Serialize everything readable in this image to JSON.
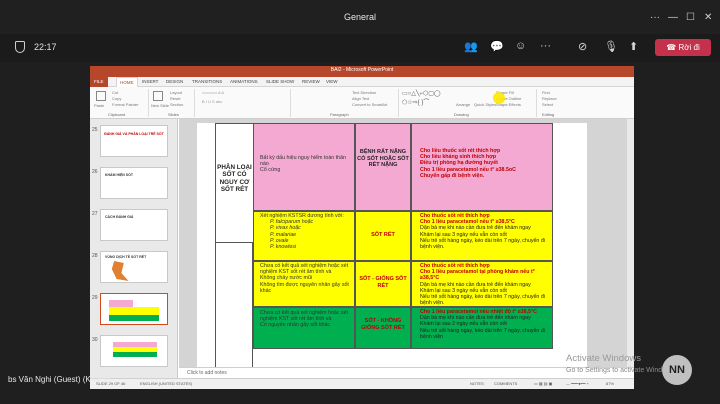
{
  "teams": {
    "title": "General",
    "time": "22:17",
    "leave_label": "Rời đi",
    "guest_name": "bs Văn Nghi (Guest) (Khách)",
    "avatar_initials": "NN",
    "watermark_line1": "Activate Windows",
    "watermark_line2": "Go to Settings to activate Windows."
  },
  "ppt": {
    "window_title": "BAI2 - Microsoft PowerPoint",
    "tabs": [
      "FILE",
      "HOME",
      "INSERT",
      "DESIGN",
      "TRANSITIONS",
      "ANIMATIONS",
      "SLIDE SHOW",
      "REVIEW",
      "VIEW"
    ],
    "ribbon": {
      "paste": "Paste",
      "cut": "Cut",
      "copy": "Copy",
      "format_painter": "Format Painter",
      "layout": "Layout",
      "reset": "Reset",
      "section": "Section",
      "new_slide": "New Slide",
      "text_direction": "Text Direction",
      "align_text": "Align Text",
      "convert_smartart": "Convert to SmartArt",
      "arrange": "Arrange",
      "quick_styles": "Quick Styles",
      "shape_fill": "Shape Fill",
      "shape_outline": "Shape Outline",
      "shape_effects": "Shape Effects",
      "find": "Find",
      "replace": "Replace",
      "select": "Select",
      "groups": [
        "Clipboard",
        "Slides",
        "Paragraph",
        "Drawing",
        "Editing"
      ]
    },
    "thumbnails": [
      {
        "num": "25",
        "title": "ĐÁNH GIÁ VÀ PHÂN LOẠI TRẺ SỐT"
      },
      {
        "num": "26",
        "title": "KHÁM HIỆN SỐT"
      },
      {
        "num": "27",
        "title": "CÁCH ĐÁNH GIÁ"
      },
      {
        "num": "28",
        "title": "VÙNG DỊCH TỄ SỐT RÉT"
      },
      {
        "num": "29",
        "title": ""
      },
      {
        "num": "30",
        "title": ""
      }
    ],
    "notes_placeholder": "Click to add notes",
    "status": {
      "slide": "SLIDE 29 OF 46",
      "lang": "ENGLISH (UNITED STATES)",
      "notes": "NOTES",
      "comments": "COMMENTS",
      "zoom": "87%"
    }
  },
  "slide_table": {
    "side_heading": "PHÂN LOẠI SỐT CÓ NGUY CƠ SỐT RÉT",
    "rows": [
      {
        "color": "#f4a9d2",
        "signs": [
          "Bất kỳ dấu hiệu nguy hiểm toàn thân nào",
          "Cổ cứng"
        ],
        "classification": "BỆNH RẤT NẶNG CÓ SỐT HOẶC SỐT RÉT NẶNG",
        "treatment": [
          "Cho liều thuốc sốt rét thích hợp",
          "Cho liều kháng sinh thích hợp",
          "Điều trị phòng hạ đường huyết",
          "Cho 1 liều paracetamol nếu t° ≥38.5oC",
          "Chuyển gấp đi bệnh viện."
        ]
      },
      {
        "color": "#ffff00",
        "signs": [
          "Xét nghiệm KSTSR dương tính với:",
          "P. falciparum hoặc",
          "P. vivax hoặc",
          "P. malariae",
          "P. ovale",
          "P. knowlesi"
        ],
        "classification": "SỐT RÉT",
        "treatment": [
          "Cho thuốc sốt rét thích hợp",
          "Cho 1 liều paracetamol nếu t° ≥38,5°C",
          "Dặn bà mẹ khi nào cần đưa trẻ đến khám ngay",
          "Khám lại sau 3 ngày nếu vẫn còn sốt",
          "Nếu trẻ sốt hàng ngày, kéo dài trên 7 ngày, chuyển đi bệnh viện."
        ]
      },
      {
        "color": "#ffff00",
        "signs": [
          "Chưa có kết quả xét nghiệm hoặc xét nghiệm KST sốt rét âm tính và",
          "Không chảy nước mũi",
          "Không tìm được nguyên nhân gây sốt khác"
        ],
        "classification": "SỐT - GIỐNG SỐT RÉT",
        "treatment": [
          "Cho thuốc sốt rét thích hợp",
          "Cho 1 liều paracetamol tại phòng khám nếu t° ≥38,5°C",
          "Dặn bà mẹ khi nào cần đưa trẻ đến khám ngay",
          "Khám lại sau 3 ngày nếu vẫn còn sốt",
          "Nếu trẻ sốt hàng ngày, kéo dài trên 7 ngày, chuyển đi bệnh viện."
        ]
      },
      {
        "color": "#00b050",
        "signs": [
          "Chưa có kết quả xét nghiệm hoặc xét nghiệm KST sốt rét âm tính và",
          "Có nguyên nhân gây sốt khác"
        ],
        "classification": "SỐT - KHÔNG GIỐNG SỐT RÉT",
        "treatment": [
          "Cho 1 liều paracetamol nếu nhiệt độ t° ≥38,5°C",
          "Dặn bà mẹ khi nào cần đưa trẻ đến khám ngay",
          "Khám lại sau 2 ngày nếu vẫn còn sốt",
          "Nếu trẻ sốt hàng ngày, kéo dài trên 7 ngày, chuyển đi bệnh viện"
        ]
      }
    ]
  }
}
